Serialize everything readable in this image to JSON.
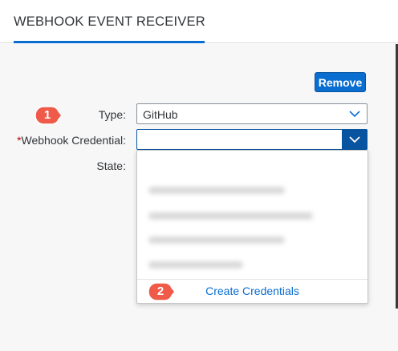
{
  "header": {
    "title": "WEBHOOK EVENT RECEIVER"
  },
  "actions": {
    "remove_label": "Remove"
  },
  "form": {
    "type_label": "Type:",
    "type_value": "GitHub",
    "credential_required_mark": "*",
    "credential_label": "Webhook Credential:",
    "credential_value": "",
    "state_label": "State:"
  },
  "dropdown": {
    "blurred_items": 4,
    "create_label": "Create Credentials"
  },
  "callouts": [
    "1",
    "2"
  ],
  "colors": {
    "accent": "#0a6ed1",
    "accent_dark": "#0854a0",
    "callout": "#ef5a49",
    "required": "#bb0000"
  }
}
